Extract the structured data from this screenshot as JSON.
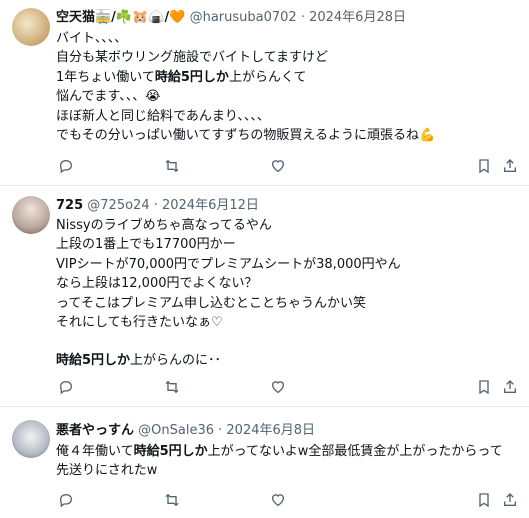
{
  "tweets": [
    {
      "name": "空天猫🚋/☘️🐹🍙/🧡",
      "handle": "@harusuba0702",
      "date": "· 2024年6月28日",
      "lines": [
        {
          "segments": [
            {
              "t": "バイト、、、、"
            }
          ]
        },
        {
          "segments": [
            {
              "t": "自分も某ボウリング施設でバイトしてますけど"
            }
          ]
        },
        {
          "segments": [
            {
              "t": "1年ちょい働いて"
            },
            {
              "t": "時給5円しか",
              "bold": true
            },
            {
              "t": "上がらんくて"
            }
          ]
        },
        {
          "segments": [
            {
              "t": "悩んでます、、、😭"
            }
          ]
        },
        {
          "segments": [
            {
              "t": "ほぼ新人と同じ給料であんまり、、、、"
            }
          ]
        },
        {
          "segments": [
            {
              "t": "でもその分いっぱい働いてすずちの物販買えるように頑張るね💪"
            }
          ]
        }
      ]
    },
    {
      "name": "725",
      "handle": "@725o24",
      "date": "· 2024年6月12日",
      "lines": [
        {
          "segments": [
            {
              "t": "Nissyのライブめちゃ高なってるやん"
            }
          ]
        },
        {
          "segments": [
            {
              "t": "上段の1番上でも17700円かー"
            }
          ]
        },
        {
          "segments": [
            {
              "t": "VIPシートが70,000円でプレミアムシートが38,000円やん"
            }
          ]
        },
        {
          "segments": [
            {
              "t": "なら上段は12,000円でよくない？"
            }
          ]
        },
        {
          "segments": [
            {
              "t": "ってそこはプレミアム申し込むとことちゃうんかい笑"
            }
          ]
        },
        {
          "segments": [
            {
              "t": "それにしても行きたいなぁ♡"
            }
          ]
        },
        {
          "segments": [
            {
              "t": ""
            }
          ]
        },
        {
          "segments": [
            {
              "t": "時給5円しか",
              "bold": true
            },
            {
              "t": "上がらんのに･･"
            }
          ]
        }
      ]
    },
    {
      "name": "悪者やっすん",
      "handle": "@OnSale36",
      "date": "· 2024年6月8日",
      "lines": [
        {
          "segments": [
            {
              "t": "俺４年働いて"
            },
            {
              "t": "時給5円しか",
              "bold": true
            },
            {
              "t": "上がってないよw全部最低賃金が上がったからって"
            }
          ]
        },
        {
          "segments": [
            {
              "t": "先送りにされたw"
            }
          ]
        }
      ]
    }
  ],
  "icons": [
    "reply-icon",
    "retweet-icon",
    "like-icon",
    "bookmark-icon",
    "share-icon"
  ],
  "colors": {
    "text": "#0f1419",
    "secondary": "#536471",
    "divider": "#e6ecf0"
  }
}
